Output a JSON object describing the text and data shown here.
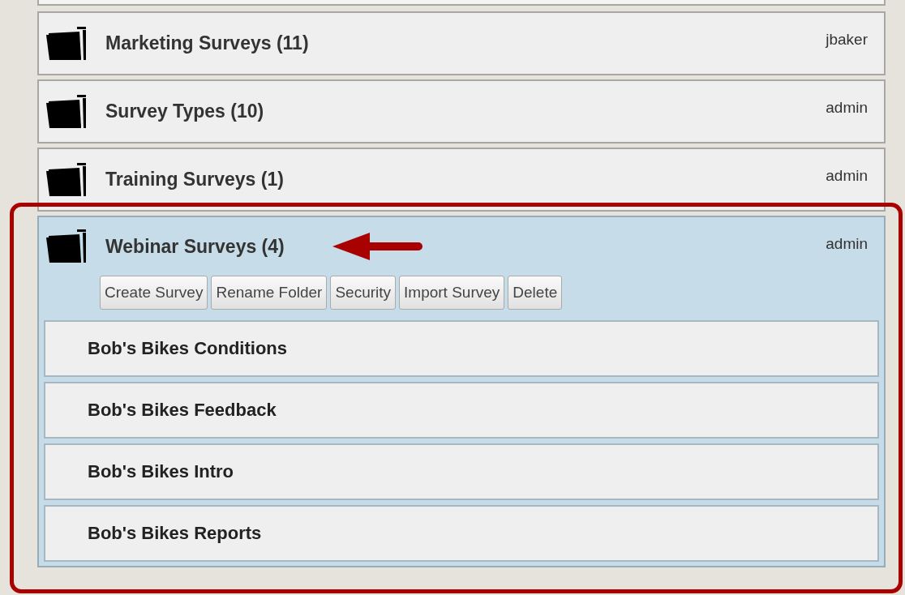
{
  "folders": [
    {
      "title": "Marketing Surveys (11)",
      "owner": "jbaker",
      "expanded": false
    },
    {
      "title": "Survey Types (10)",
      "owner": "admin",
      "expanded": false
    },
    {
      "title": "Training Surveys (1)",
      "owner": "admin",
      "expanded": false
    },
    {
      "title": "Webinar Surveys (4)",
      "owner": "admin",
      "expanded": true,
      "actions": [
        "Create Survey",
        "Rename Folder",
        "Security",
        "Import Survey",
        "Delete"
      ],
      "surveys": [
        "Bob's Bikes Conditions",
        "Bob's Bikes Feedback",
        "Bob's Bikes Intro",
        "Bob's Bikes Reports"
      ]
    }
  ],
  "callout": {
    "highlight_box": true,
    "arrow": true
  }
}
